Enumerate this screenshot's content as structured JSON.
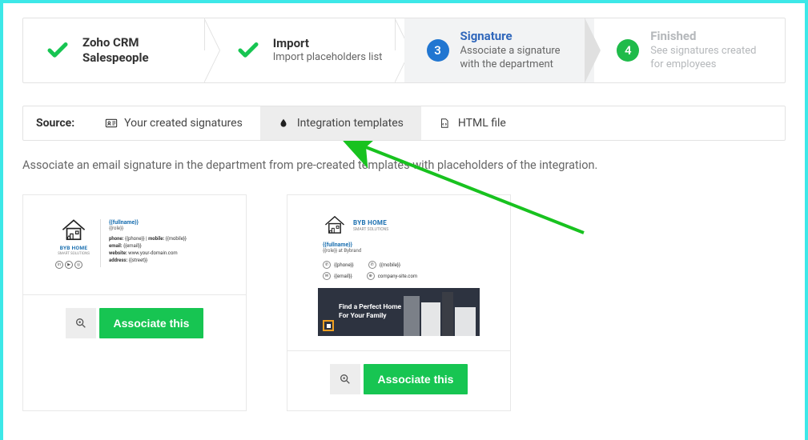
{
  "stepper": {
    "steps": [
      {
        "title": "Zoho CRM Salespeople",
        "desc": ""
      },
      {
        "title": "Import",
        "desc": "Import placeholders list"
      },
      {
        "num": "3",
        "title": "Signature",
        "desc": "Associate a signature with the department"
      },
      {
        "num": "4",
        "title": "Finished",
        "desc": "See signatures created for employees"
      }
    ]
  },
  "source": {
    "label": "Source:",
    "tabs": [
      {
        "label": "Your created signatures"
      },
      {
        "label": "Integration templates"
      },
      {
        "label": "HTML file"
      }
    ]
  },
  "instructions": "Associate an email signature in the department from pre-created templates with placeholders of the integration.",
  "cards": {
    "brand": "BYB HOME",
    "brand_sub": "SMART SOLUTIONS",
    "small": {
      "fullname": "{{fullname}}",
      "role": "{{role}}",
      "phone_label": "phone:",
      "phone": "{{phone}}",
      "mobile_label": "mobile:",
      "mobile": "{{mobile}}",
      "email_label": "email:",
      "email": "{{email}}",
      "website_label": "website:",
      "website": "www.your-domain.com",
      "address_label": "address:",
      "address": "{{street}}"
    },
    "big": {
      "fullname": "{{fullname}}",
      "role": "{{role}} at Bybrand",
      "phone": "{{phone}}",
      "mobile": "{{mobile}}",
      "email": "{{email}}",
      "site": "company-site.com",
      "banner_line1": "Find a Perfect Home",
      "banner_line2": "For Your Family"
    },
    "associate_label": "Associate this"
  }
}
